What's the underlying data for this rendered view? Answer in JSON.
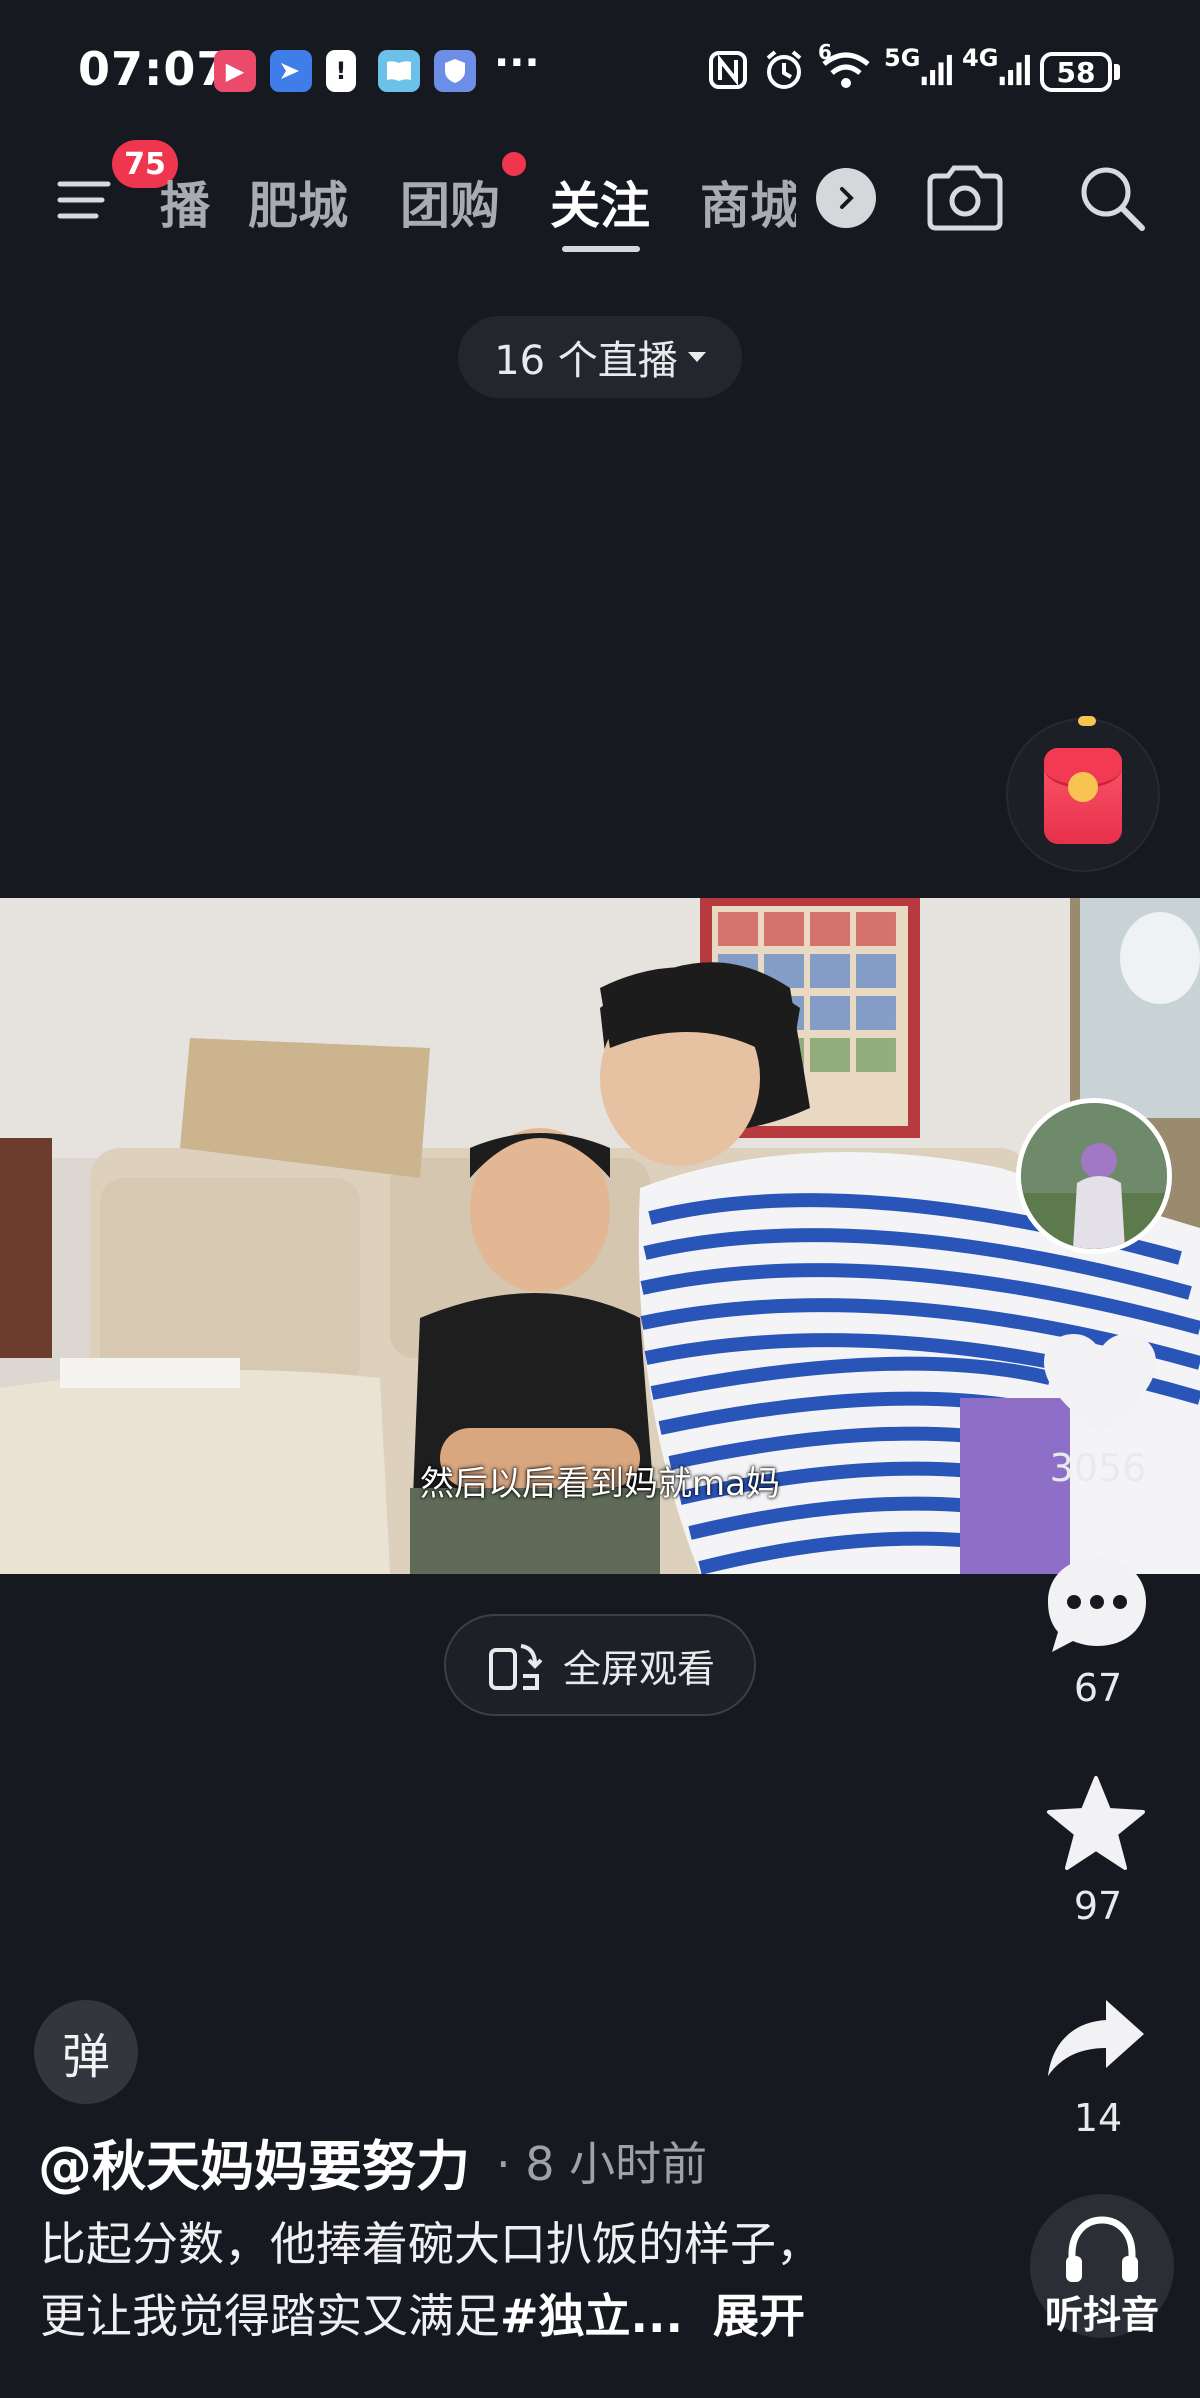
{
  "status_bar": {
    "time": "07:07",
    "more": "···",
    "battery": "58",
    "network_5g": "5G",
    "network_4g": "4G",
    "wifi_badge": "6"
  },
  "nav": {
    "menu_badge": "75",
    "tabs": [
      {
        "label": "播",
        "active": false
      },
      {
        "label": "肥城",
        "active": false
      },
      {
        "label": "团购",
        "active": false
      },
      {
        "label": "关注",
        "active": true
      },
      {
        "label": "商城",
        "active": false
      }
    ]
  },
  "live": {
    "label": "16 个直播"
  },
  "video": {
    "subtitle": "然后以后看到妈就ma妈",
    "fullscreen_label": "全屏观看"
  },
  "rail": {
    "likes": "3056",
    "comments": "67",
    "favorites": "97",
    "shares": "14",
    "listen_label": "听抖音"
  },
  "post": {
    "danmu_label": "弹",
    "author": "@秋天妈妈要努力",
    "time_ago": "· 8 小时前",
    "caption_line1": "比起分数，他捧着碗大口扒饭的样子，",
    "caption_line2": "更让我觉得踏实又满足",
    "hashtag": "#独立...",
    "expand": "展开"
  },
  "colors": {
    "background": "#161920",
    "badge_red": "#f0364f",
    "inactive_tab": "#a8abb2",
    "stripe_blue": "#2a55b8"
  }
}
